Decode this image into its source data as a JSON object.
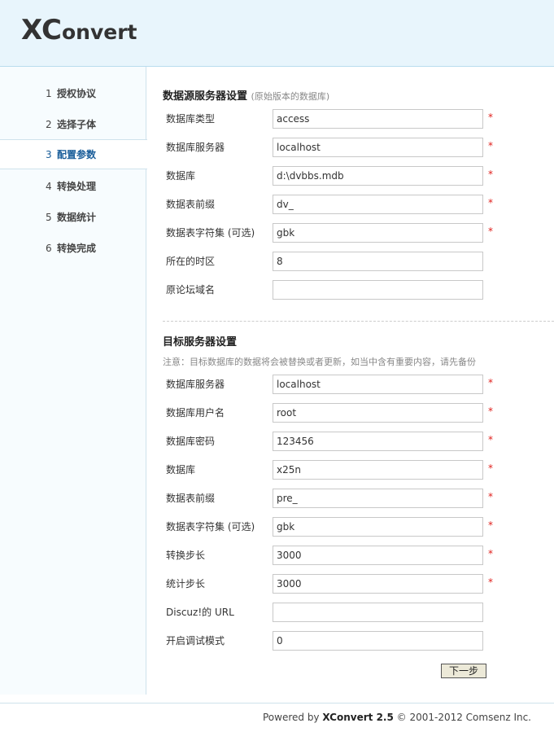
{
  "header": {
    "logo_big": "XC",
    "logo_rest": "onvert"
  },
  "sidebar": {
    "steps": [
      {
        "num": "1",
        "label": "授权协议"
      },
      {
        "num": "2",
        "label": "选择子体"
      },
      {
        "num": "3",
        "label": "配置参数"
      },
      {
        "num": "4",
        "label": "转换处理"
      },
      {
        "num": "5",
        "label": "数据统计"
      },
      {
        "num": "6",
        "label": "转换完成"
      }
    ],
    "active_index": 2
  },
  "source": {
    "title": "数据源服务器设置",
    "subtitle": "(原始版本的数据库)",
    "fields": [
      {
        "label": "数据库类型",
        "value": "access",
        "required": "*"
      },
      {
        "label": "数据库服务器",
        "value": "localhost",
        "required": "*"
      },
      {
        "label": "数据库",
        "value": "d:\\dvbbs.mdb",
        "required": "*"
      },
      {
        "label": "数据表前缀",
        "value": "dv_",
        "required": "*"
      },
      {
        "label": "数据表字符集 (可选)",
        "value": "gbk",
        "required": "*"
      },
      {
        "label": "所在的时区",
        "value": "8",
        "required": ""
      },
      {
        "label": "原论坛域名",
        "value": "",
        "required": ""
      }
    ]
  },
  "target": {
    "title": "目标服务器设置",
    "note": "注意：目标数据库的数据将会被替换或者更新，如当中含有重要内容，请先备份",
    "fields": [
      {
        "label": "数据库服务器",
        "value": "localhost",
        "required": "*"
      },
      {
        "label": "数据库用户名",
        "value": "root",
        "required": "*"
      },
      {
        "label": "数据库密码",
        "value": "123456",
        "required": "*"
      },
      {
        "label": "数据库",
        "value": "x25n",
        "required": "*"
      },
      {
        "label": "数据表前缀",
        "value": "pre_",
        "required": "*"
      },
      {
        "label": "数据表字符集 (可选)",
        "value": "gbk",
        "required": "*"
      },
      {
        "label": "转换步长",
        "value": "3000",
        "required": "*"
      },
      {
        "label": "统计步长",
        "value": "3000",
        "required": "*"
      },
      {
        "label": "Discuz!的 URL",
        "value": "",
        "required": ""
      },
      {
        "label": "开启调试模式",
        "value": "0",
        "required": ""
      }
    ]
  },
  "next_button": "下一步",
  "footer": {
    "powered_prefix": "Powered by ",
    "product": "XConvert 2.5",
    "copyright": " © 2001-2012 Comsenz Inc."
  }
}
